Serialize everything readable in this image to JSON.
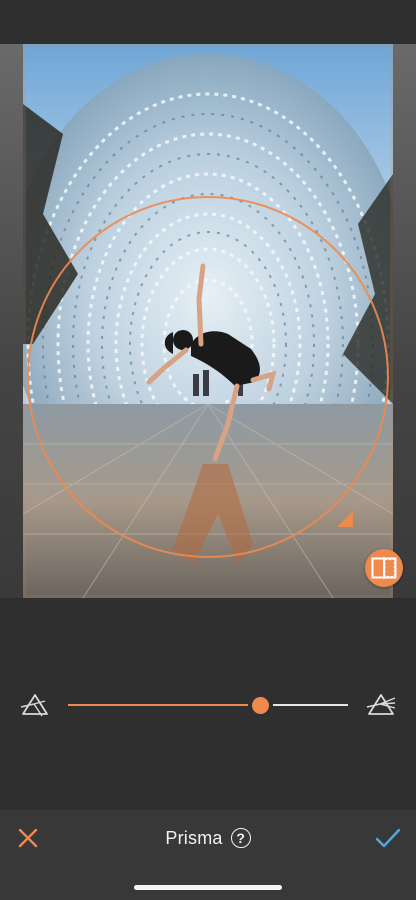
{
  "toolbar": {
    "title": "Prisma",
    "help_glyph": "?"
  },
  "slider": {
    "value_fraction": 0.68,
    "min_icon": "prism-icon",
    "max_icon": "prism-icon"
  },
  "icons": {
    "cancel": "close-icon",
    "confirm": "checkmark-icon",
    "compare": "compare-icon",
    "help": "help-icon"
  },
  "colors": {
    "accent": "#ee8a4e",
    "confirm": "#4fa8e0",
    "background": "#2f2f2f",
    "bottom_bar": "#383838"
  }
}
